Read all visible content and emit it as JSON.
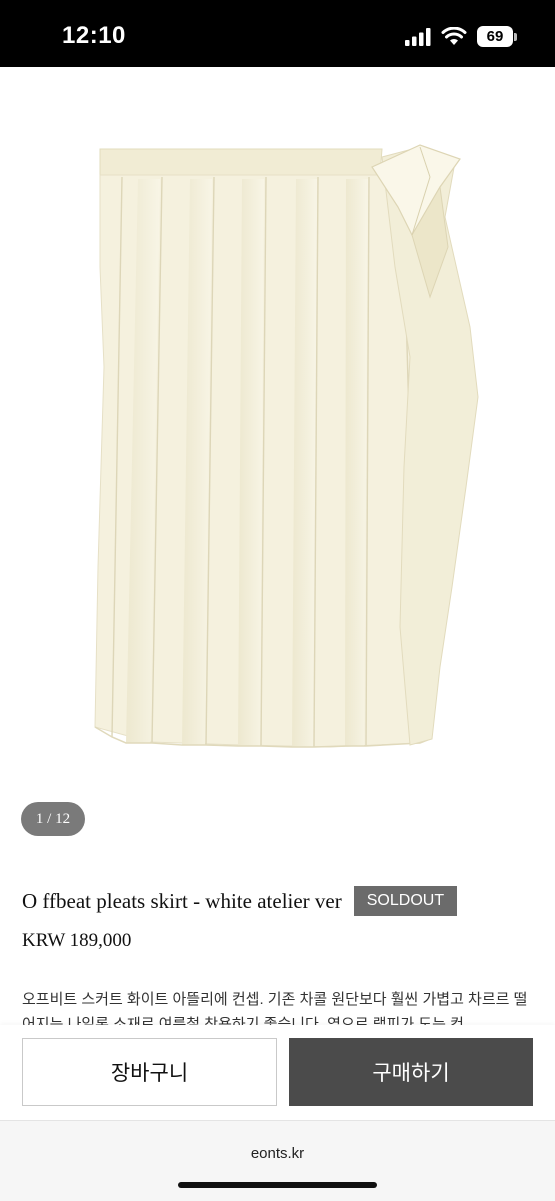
{
  "status_bar": {
    "time": "12:10",
    "battery": "69"
  },
  "gallery": {
    "counter": "1 / 12"
  },
  "product": {
    "title": "O ffbeat pleats skirt - white atelier ver",
    "badge": "SOLDOUT",
    "price": "KRW 189,000",
    "description": "오프비트 스커트 화이트 아뜰리에 컨셉. 기존 차콜 원단보다 훨씬 가볍고 차르르 떨어지는 나일론 소재로 여름철 착용하기 좋습니다. 옆으로 랩피가 도는 컨"
  },
  "actions": {
    "cart_label": "장바구니",
    "buy_label": "구매하기"
  },
  "browser": {
    "url": "eonts.kr"
  },
  "colors": {
    "status_bar": "#000000",
    "badge": "#6b6b6b",
    "buy_button": "#4b4b4b",
    "skirt": "#f4f0dc"
  }
}
